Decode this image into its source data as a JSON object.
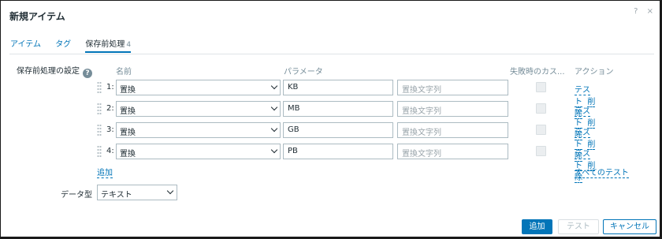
{
  "dialog": {
    "title": "新規アイテム",
    "help_icon": "?",
    "close_icon": "×"
  },
  "tabs": [
    {
      "label": "アイテム"
    },
    {
      "label": "タグ"
    },
    {
      "label": "保存前処理",
      "count": "4"
    }
  ],
  "preprocessing": {
    "label": "保存前処理の設定",
    "help_icon": "?",
    "headers": {
      "name": "名前",
      "params": "パラメータ",
      "on_fail": "失敗時のカス...",
      "actions": "アクション"
    },
    "steps": [
      {
        "no": "1:",
        "type": "置換",
        "param1": "KB",
        "param2_placeholder": "置換文字列",
        "test": "テスト",
        "remove": "削除"
      },
      {
        "no": "2:",
        "type": "置換",
        "param1": "MB",
        "param2_placeholder": "置換文字列",
        "test": "テスト",
        "remove": "削除"
      },
      {
        "no": "3:",
        "type": "置換",
        "param1": "GB",
        "param2_placeholder": "置換文字列",
        "test": "テスト",
        "remove": "削除"
      },
      {
        "no": "4:",
        "type": "置換",
        "param1": "PB",
        "param2_placeholder": "置換文字列",
        "test": "テスト",
        "remove": "削除"
      }
    ],
    "add_label": "追加",
    "test_all_label": "すべてのテスト"
  },
  "data_type": {
    "label": "データ型",
    "value": "テキスト"
  },
  "footer": {
    "add": "追加",
    "test": "テスト",
    "cancel": "キャンセル"
  },
  "colors": {
    "accent": "#0275b8",
    "text": "#1f2c33",
    "muted": "#768d99"
  }
}
